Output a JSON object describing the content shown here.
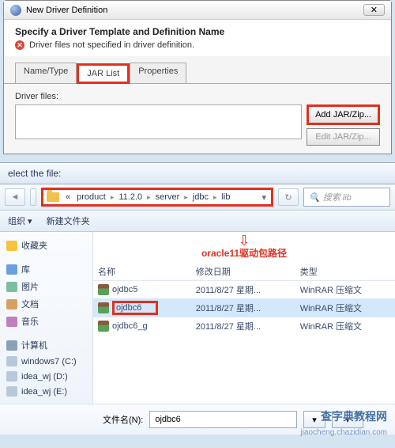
{
  "dialog1": {
    "title": "New Driver Definition",
    "close": "✕",
    "heading": "Specify a Driver Template and Definition Name",
    "error": "Driver files not specified in driver definition.",
    "tabs": {
      "name": "Name/Type",
      "jar": "JAR List",
      "props": "Properties"
    },
    "driver_label": "Driver files:",
    "add_btn": "Add JAR/Zip...",
    "edit_btn": "Edit JAR/Zip..."
  },
  "dialog2": {
    "title": "elect the file:",
    "search_placeholder": "搜索 lib",
    "crumbs": {
      "pre": "«",
      "c1": "product",
      "c2": "11.2.0",
      "c3": "server",
      "c4": "jdbc",
      "c5": "lib"
    },
    "tb": {
      "org": "组织 ▾",
      "new": "新建文件夹"
    },
    "side": {
      "fav": "收藏夹",
      "lib": "库",
      "pic": "图片",
      "doc": "文档",
      "mus": "音乐",
      "comp": "计算机",
      "d1": "windows7 (C:)",
      "d2": "idea_wj (D:)",
      "d3": "idea_wj (E:)"
    },
    "annotation": "oracle11驱动包路径",
    "cols": {
      "name": "名称",
      "date": "修改日期",
      "type": "类型"
    },
    "rows": [
      {
        "n": "ojdbc5",
        "d": "2011/8/27 星期...",
        "t": "WinRAR 压缩文"
      },
      {
        "n": "ojdbc6",
        "d": "2011/8/27 星期...",
        "t": "WinRAR 压缩文"
      },
      {
        "n": "ojdbc6_g",
        "d": "2011/8/27 星期...",
        "t": "WinRAR 压缩文"
      }
    ],
    "fn_label": "文件名(N):",
    "fn_value": "ojdbc6"
  },
  "watermark": {
    "a": "查字典教程网",
    "b": "jiaocheng.chazidian.com"
  }
}
